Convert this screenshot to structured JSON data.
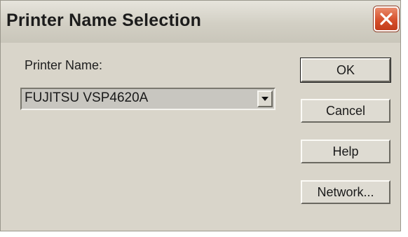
{
  "dialog": {
    "title": "Printer Name Selection",
    "printer_label": "Printer Name:",
    "printer_value": "FUJITSU VSP4620A"
  },
  "buttons": {
    "ok": "OK",
    "cancel": "Cancel",
    "help": "Help",
    "network": "Network..."
  },
  "icons": {
    "close": "close-icon",
    "dropdown": "chevron-down-icon"
  },
  "colors": {
    "close_button": "#d6502c",
    "dialog_background": "#d9d5ca"
  }
}
